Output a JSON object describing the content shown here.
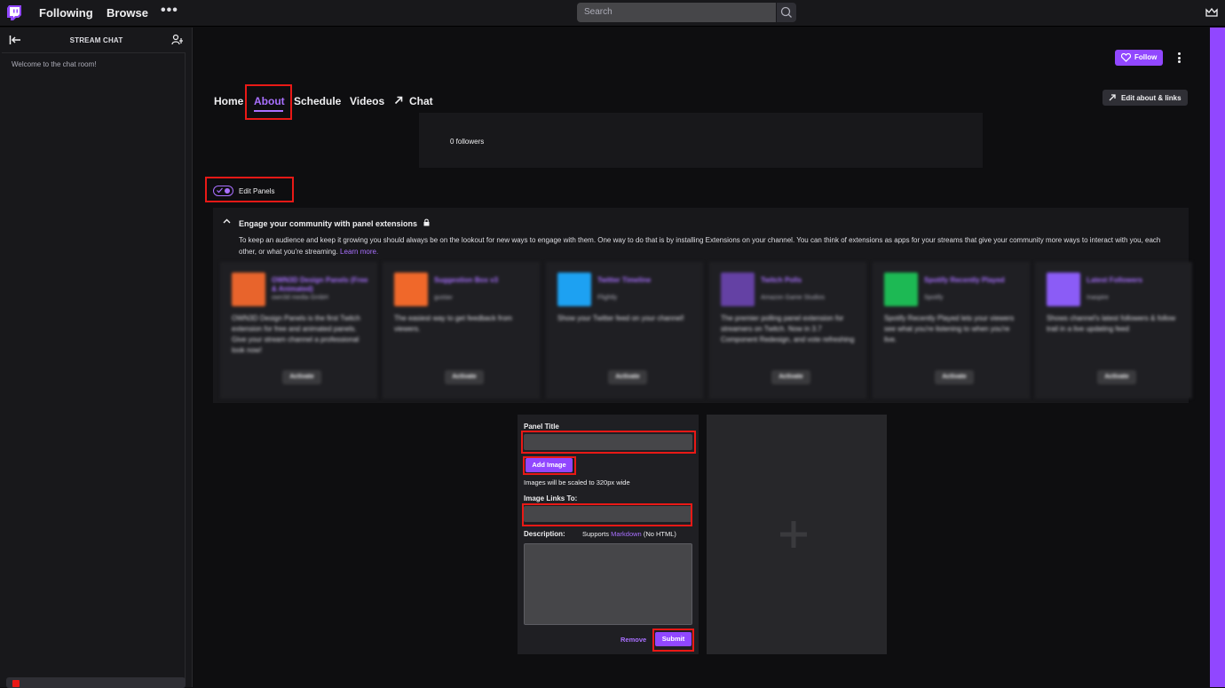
{
  "nav": {
    "following": "Following",
    "browse": "Browse",
    "more": "•••",
    "search_placeholder": "Search"
  },
  "sidebar": {
    "title": "STREAM CHAT",
    "welcome": "Welcome to the chat room!"
  },
  "header": {
    "follow": "Follow",
    "edit_about": "Edit about & links"
  },
  "tabs": [
    {
      "label": "Home"
    },
    {
      "label": "About",
      "active": true
    },
    {
      "label": "Schedule"
    },
    {
      "label": "Videos"
    },
    {
      "label": "Chat"
    }
  ],
  "followers": "0 followers",
  "edit_panels": "Edit Panels",
  "extensions": {
    "title": "Engage your community with panel extensions",
    "desc_before": "To keep an audience and keep it growing you should always be on the lookout for new ways to engage with them. One way to do that is by installing Extensions on your channel. You can think of extensions as apps for your streams that give your community more ways to interact with you, each other, or what you're streaming.",
    "learn_more": "Learn more.",
    "cards": [
      {
        "name": "OWN3D Design Panels (Free & Animated)",
        "author": "own3d media GmbH",
        "desc": "OWN3D Design Panels is the first Twitch extension for free and animated panels. Give your stream channel a professional look now!",
        "button": "Activate",
        "color": "#e8642c"
      },
      {
        "name": "Suggestion Box v3",
        "author": "gustav",
        "desc": "The easiest way to get feedback from viewers.",
        "button": "Activate",
        "color": "#f0682a"
      },
      {
        "name": "Twitter Timeline",
        "author": "Flightly",
        "desc": "Show your Twitter feed on your channel!",
        "button": "Activate",
        "color": "#1da1f2"
      },
      {
        "name": "Twitch Polls",
        "author": "Amazon Game Studios",
        "desc": "The premier polling panel extension for streamers on Twitch. Now in 3.7 Component Redesign, and vote refreshing",
        "button": "Activate",
        "color": "#6441a4"
      },
      {
        "name": "Spotify Recently Played",
        "author": "Spotify",
        "desc": "Spotify Recently Played lets your viewers see what you're listening to when you're live.",
        "button": "Activate",
        "color": "#1db954"
      },
      {
        "name": "Latest Followers",
        "author": "Inaspire",
        "desc": "Shows channel's latest followers & follow trail in a live updating feed",
        "button": "Activate",
        "color": "#8b5cf6"
      }
    ]
  },
  "panel_form": {
    "title_label": "Panel Title",
    "add_image": "Add Image",
    "image_hint": "Images will be scaled to 320px wide",
    "links_label": "Image Links To:",
    "description_label": "Description:",
    "supports_before": "Supports",
    "supports_link": "Markdown",
    "supports_after": "(No HTML)",
    "remove": "Remove",
    "submit": "Submit"
  },
  "colors": {
    "accent": "#9147ff",
    "highlight": "#e91916",
    "background": "#0e0e10"
  }
}
